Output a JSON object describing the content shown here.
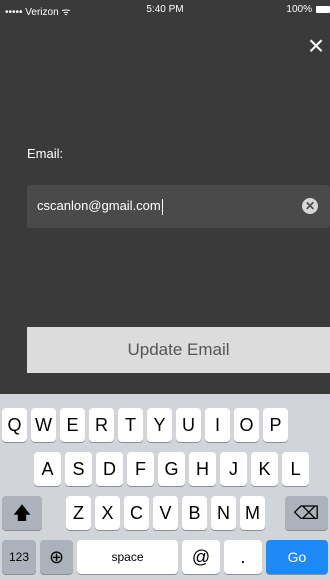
{
  "status_bar": {
    "carrier": "••••• Verizon ᯤ",
    "time": "5:40 PM",
    "battery": "100%"
  },
  "close_icon": "×",
  "email": {
    "label": "Email:",
    "value": "cscanlon@gmail.com",
    "clear_icon": "✕"
  },
  "update_button": "Update Email",
  "keyboard": {
    "row1": [
      "Q",
      "W",
      "E",
      "R",
      "T",
      "Y",
      "U",
      "I",
      "O",
      "P"
    ],
    "row2": [
      "A",
      "S",
      "D",
      "F",
      "G",
      "H",
      "J",
      "K",
      "L"
    ],
    "row3": [
      "Z",
      "X",
      "C",
      "V",
      "B",
      "N",
      "M"
    ],
    "shift_icon": "🡅",
    "backspace_icon": "⌫",
    "numbers": "123",
    "globe_icon": "⊕",
    "space": "space",
    "at": "@",
    "dot": ".",
    "go": "Go"
  }
}
